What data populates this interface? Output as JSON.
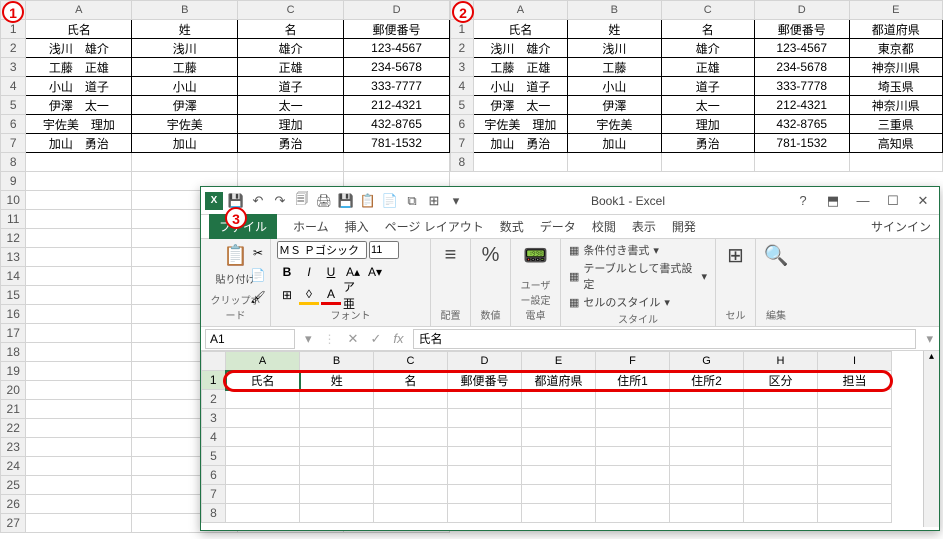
{
  "badge1": "1",
  "badge2": "2",
  "badge3": "3",
  "sheet1": {
    "cols": [
      "A",
      "B",
      "C",
      "D"
    ],
    "headers": [
      "氏名",
      "姓",
      "名",
      "郵便番号"
    ],
    "rows": [
      [
        "浅川　雄介",
        "浅川",
        "雄介",
        "123-4567"
      ],
      [
        "工藤　正雄",
        "工藤",
        "正雄",
        "234-5678"
      ],
      [
        "小山　道子",
        "小山",
        "道子",
        "333-7777"
      ],
      [
        "伊澤　太一",
        "伊澤",
        "太一",
        "212-4321"
      ],
      [
        "宇佐美　理加",
        "宇佐美",
        "理加",
        "432-8765"
      ],
      [
        "加山　勇治",
        "加山",
        "勇治",
        "781-1532"
      ]
    ]
  },
  "sheet2": {
    "cols": [
      "A",
      "B",
      "C",
      "D",
      "E"
    ],
    "headers": [
      "氏名",
      "姓",
      "名",
      "郵便番号",
      "都道府県"
    ],
    "rows": [
      [
        "浅川　雄介",
        "浅川",
        "雄介",
        "123-4567",
        "東京都"
      ],
      [
        "工藤　正雄",
        "工藤",
        "正雄",
        "234-5678",
        "神奈川県"
      ],
      [
        "小山　道子",
        "小山",
        "道子",
        "333-7778",
        "埼玉県"
      ],
      [
        "伊澤　太一",
        "伊澤",
        "太一",
        "212-4321",
        "神奈川県"
      ],
      [
        "宇佐美　理加",
        "宇佐美",
        "理加",
        "432-8765",
        "三重県"
      ],
      [
        "加山　勇治",
        "加山",
        "勇治",
        "781-1532",
        "高知県"
      ]
    ]
  },
  "excel": {
    "title": "Book1 - Excel",
    "file": "ファイル",
    "tabs": [
      "ホーム",
      "挿入",
      "ページ レイアウト",
      "数式",
      "データ",
      "校閲",
      "表示",
      "開発"
    ],
    "signin": "サインイン",
    "font_name": "ＭＳ Ｐゴシック",
    "font_size": "11",
    "groups": {
      "clipboard": "クリップボード",
      "font": "フォント",
      "alignment": "配置",
      "number": "数値",
      "calc": "ユーザー設定　電卓",
      "styles": "スタイル",
      "cells": "セル",
      "editing": "編集"
    },
    "paste": "貼り付け",
    "calc": "電卓",
    "styles_items": {
      "conditional": "条件付き書式",
      "format_table": "テーブルとして書式設定",
      "cell_styles": "セルのスタイル"
    },
    "name_box": "A1",
    "formula": "氏名",
    "grid": {
      "cols": [
        "A",
        "B",
        "C",
        "D",
        "E",
        "F",
        "G",
        "H",
        "I"
      ],
      "headers": [
        "氏名",
        "姓",
        "名",
        "郵便番号",
        "都道府県",
        "住所1",
        "住所2",
        "区分",
        "担当"
      ]
    }
  }
}
